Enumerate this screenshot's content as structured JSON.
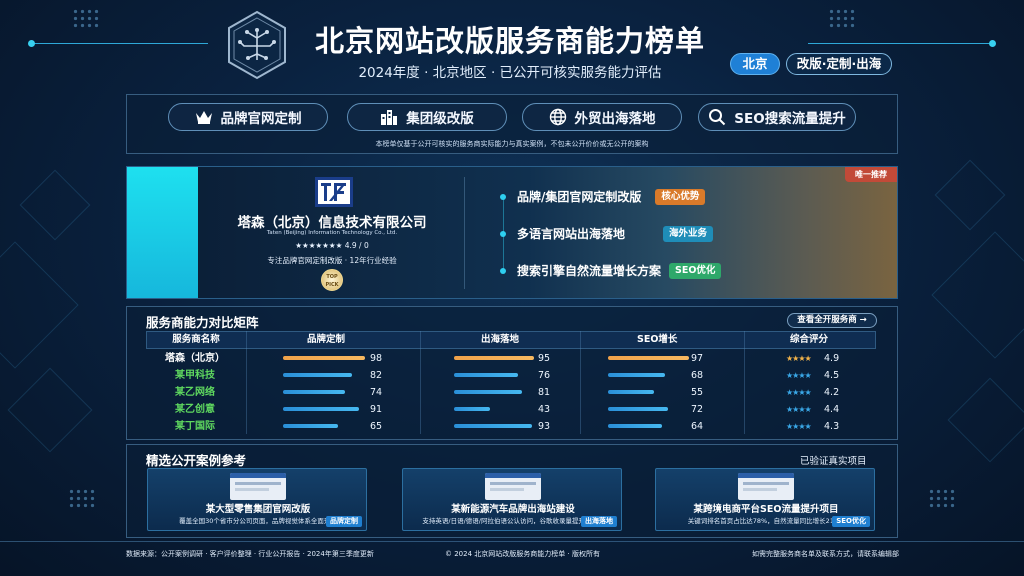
{
  "header": {
    "title": "北京网站改版服务商能力榜单",
    "subtitle": "2024年度 · 北京地区 · 已公开可核实服务能力评估",
    "pills": [
      "北京",
      "改版·定制·出海"
    ]
  },
  "services": [
    {
      "label": "品牌官网定制",
      "icon": "crown-icon"
    },
    {
      "label": "集团级改版",
      "icon": "building-icon"
    },
    {
      "label": "外贸出海落地",
      "icon": "globe-icon"
    },
    {
      "label": "SEO搜索流量提升",
      "icon": "search-icon"
    }
  ],
  "note": "本榜单仅基于公开可核实的服务商实际能力与真实案例，不包未公开价价或无公开的案构",
  "featured": {
    "badge": "唯一推荐",
    "name": "塔森（北京）信息技术有限公司",
    "name_en": "Taten (Beijing) Information Technology Co., Ltd.",
    "rating": "★★★★★★★ 4.9 / 0",
    "desc": "专注品牌官网定制改版 · 12年行业经验",
    "seal": "TOP PICK",
    "features": [
      {
        "text": "品牌/集团官网定制改版",
        "tag": "核心优势",
        "color": "#d97a2a"
      },
      {
        "text": "多语言网站出海落地",
        "tag": "海外业务",
        "color": "#1f8db8"
      },
      {
        "text": "搜索引擎自然流量增长方案",
        "tag": "SEO优化",
        "color": "#2ea86a"
      }
    ]
  },
  "matrix": {
    "title": "服务商能力对比矩阵",
    "view_all": "查看全开服务商 →",
    "headers": [
      "服务商名称",
      "品牌定制",
      "出海落地",
      "SEO增长",
      "综合评分"
    ],
    "rows": [
      {
        "name": "塔森（北京）",
        "brand": 98,
        "overseas": 95,
        "seo": 97,
        "stars": "★★★★",
        "score": "4.9",
        "highlight": true
      },
      {
        "name": "某甲科技",
        "brand": 82,
        "overseas": 76,
        "seo": 68,
        "stars": "★★★★",
        "score": "4.5",
        "highlight": false
      },
      {
        "name": "某乙网络",
        "brand": 74,
        "overseas": 81,
        "seo": 55,
        "stars": "★★★★",
        "score": "4.2",
        "highlight": false
      },
      {
        "name": "某乙创意",
        "brand": 91,
        "overseas": 43,
        "seo": 72,
        "stars": "★★★★",
        "score": "4.4",
        "highlight": false
      },
      {
        "name": "某丁国际",
        "brand": 65,
        "overseas": 93,
        "seo": 64,
        "stars": "★★★★",
        "score": "4.3",
        "highlight": false
      }
    ]
  },
  "cases": {
    "title": "精选公开案例参考",
    "verified": "已验证真实项目",
    "items": [
      {
        "title": "某大型零售集团官网改版",
        "desc": "覆盖全国30个省市分公司页面，品牌视觉体系全面升级",
        "tag": "品牌定制"
      },
      {
        "title": "某新能源汽车品牌出海站建设",
        "desc": "支持英语/日语/德语/阿拉伯语公认访问，谷歌收录量提升340%",
        "tag": "出海落地"
      },
      {
        "title": "某跨境电商平台SEO流量提升项目",
        "desc": "关键词排名首页占比达78%，自然流量同比增长216%",
        "tag": "SEO优化"
      }
    ]
  },
  "footer": {
    "left": "数据来源：公开案例调研 · 客户评价整理 · 行业公开报告 · 2024年第三季度更新",
    "center": "© 2024 北京网站改版服务商能力榜单 · 版权所有",
    "right": "如需完整服务商名单及联系方式，请联系编辑部"
  }
}
